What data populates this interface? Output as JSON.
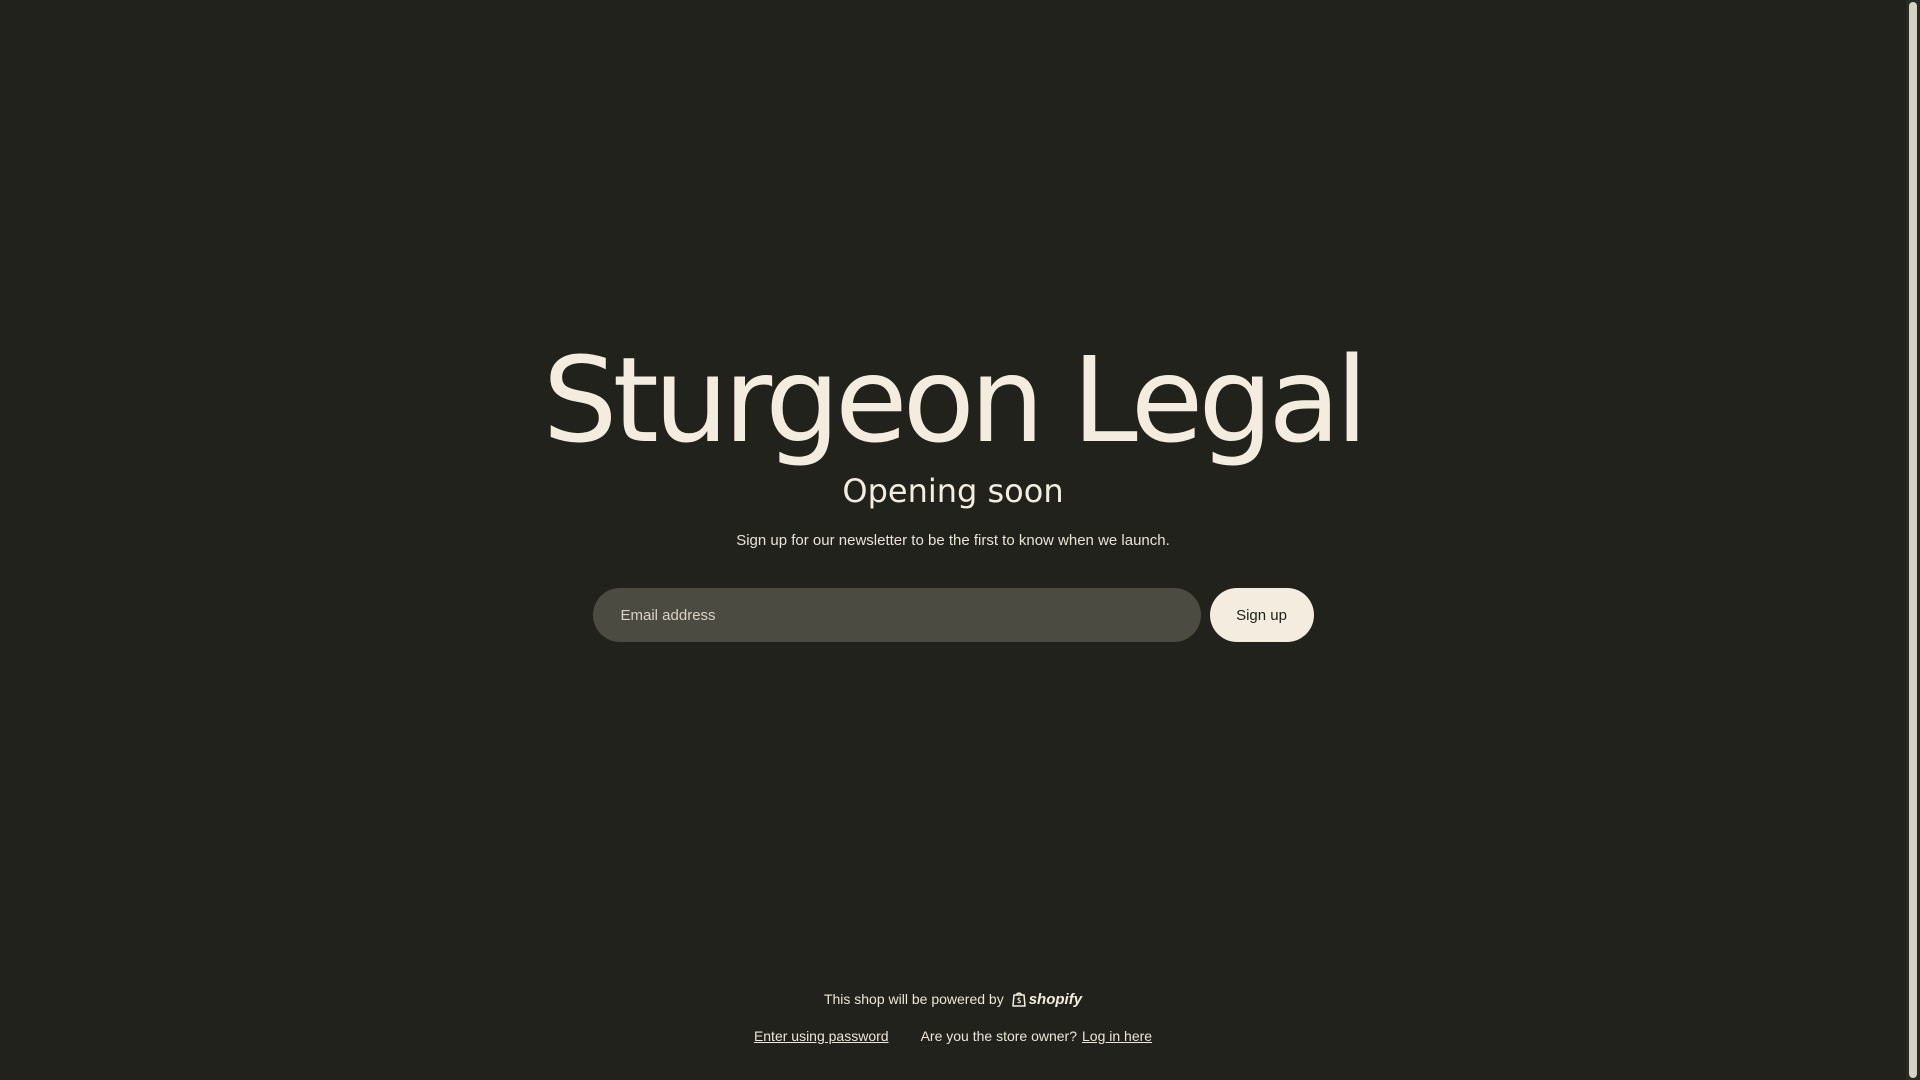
{
  "hero": {
    "store_name": "Sturgeon Legal",
    "headline": "Opening soon",
    "subtext": "Sign up for our newsletter to be the first to know when we launch."
  },
  "signup": {
    "email_placeholder": "Email address",
    "email_value": "",
    "button_label": "Sign up"
  },
  "footer": {
    "powered_by_text": "This shop will be powered by",
    "shopify_logo_text": "shopify",
    "enter_password_link": "Enter using password",
    "owner_question": "Are you the store owner?",
    "login_link": "Log in here"
  },
  "colors": {
    "background": "#21221b",
    "text": "#f3ecdf",
    "input_background": "#4c4b42",
    "button_background": "#f3ecdf",
    "button_text": "#21221b"
  },
  "icons": {
    "shopify_bag": "shopify-bag-icon"
  }
}
